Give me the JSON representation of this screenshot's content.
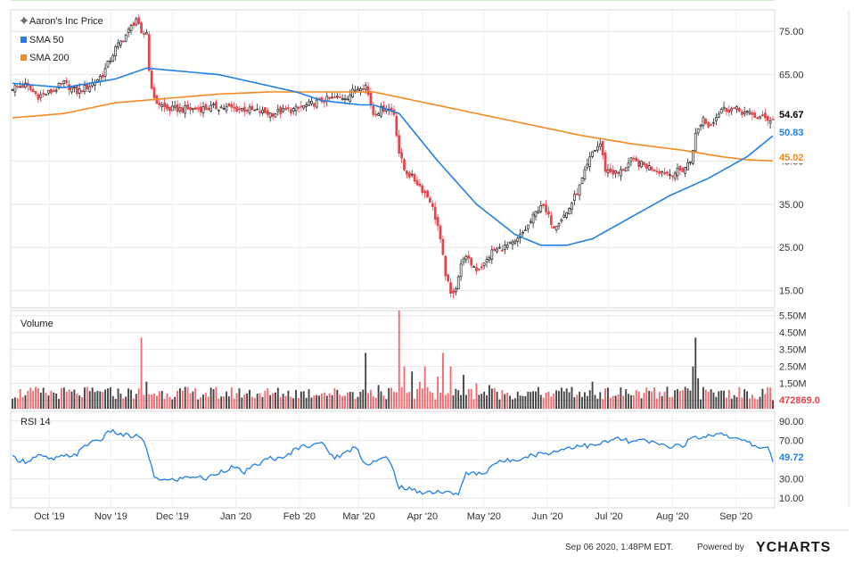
{
  "chart_data": [
    {
      "type": "candlestick",
      "legend": [
        {
          "name": "Aaron's Inc Price",
          "marker": "crosshair",
          "color": "#333333"
        },
        {
          "name": "SMA 50",
          "marker": "square",
          "color": "#1f80e6"
        },
        {
          "name": "SMA 200",
          "marker": "square",
          "color": "#f48a20"
        }
      ],
      "y_ticks": [
        "75.00",
        "65.00",
        "45.00",
        "35.00",
        "25.00",
        "15.00"
      ],
      "ylim": [
        11,
        80
      ],
      "last_labels": [
        {
          "series": "Aaron's Inc Price",
          "value": "54.67",
          "color": "#000000"
        },
        {
          "series": "SMA 50",
          "value": "50.83",
          "color": "#1f80e6"
        },
        {
          "series": "SMA 200",
          "value": "45.02",
          "color": "#f48a20"
        }
      ],
      "price_anchors": [
        [
          0,
          62
        ],
        [
          5,
          62.5
        ],
        [
          10,
          60
        ],
        [
          15,
          61
        ],
        [
          20,
          63
        ],
        [
          25,
          61
        ],
        [
          30,
          62.5
        ],
        [
          35,
          65
        ],
        [
          40,
          71
        ],
        [
          45,
          75
        ],
        [
          48,
          78
        ],
        [
          50,
          74
        ],
        [
          52,
          75
        ],
        [
          53,
          66
        ],
        [
          55,
          59
        ],
        [
          60,
          57
        ],
        [
          70,
          57
        ],
        [
          80,
          57.5
        ],
        [
          90,
          57
        ],
        [
          100,
          56
        ],
        [
          110,
          57
        ],
        [
          120,
          59
        ],
        [
          130,
          60
        ],
        [
          135,
          62.5
        ],
        [
          137,
          62.5
        ],
        [
          140,
          56
        ],
        [
          145,
          57.5
        ],
        [
          148,
          56
        ],
        [
          150,
          47
        ],
        [
          152,
          43
        ],
        [
          157,
          40
        ],
        [
          162,
          36
        ],
        [
          165,
          30
        ],
        [
          168,
          19
        ],
        [
          170,
          14
        ],
        [
          172,
          16
        ],
        [
          175,
          23
        ],
        [
          180,
          20
        ],
        [
          183,
          21
        ],
        [
          186,
          24
        ],
        [
          195,
          26
        ],
        [
          200,
          30
        ],
        [
          205,
          35
        ],
        [
          210,
          30
        ],
        [
          215,
          33
        ],
        [
          220,
          39
        ],
        [
          225,
          47
        ],
        [
          228,
          49
        ],
        [
          230,
          43
        ],
        [
          235,
          42
        ],
        [
          240,
          45
        ],
        [
          245,
          44
        ],
        [
          250,
          43
        ],
        [
          255,
          42
        ],
        [
          260,
          43
        ],
        [
          263,
          45
        ],
        [
          265,
          51
        ],
        [
          268,
          55
        ],
        [
          270,
          53
        ],
        [
          275,
          57
        ],
        [
          280,
          57
        ],
        [
          285,
          56
        ],
        [
          290,
          55
        ],
        [
          295,
          54.67
        ]
      ],
      "sma50_anchors": [
        [
          0,
          63
        ],
        [
          20,
          62
        ],
        [
          40,
          64
        ],
        [
          52,
          66.5
        ],
        [
          80,
          65
        ],
        [
          110,
          61
        ],
        [
          120,
          59
        ],
        [
          135,
          58
        ],
        [
          140,
          58
        ],
        [
          150,
          56
        ],
        [
          165,
          45
        ],
        [
          180,
          35
        ],
        [
          195,
          28
        ],
        [
          205,
          25.5
        ],
        [
          215,
          25.5
        ],
        [
          225,
          27
        ],
        [
          240,
          32
        ],
        [
          255,
          37
        ],
        [
          270,
          41
        ],
        [
          285,
          46
        ],
        [
          295,
          50.83
        ]
      ],
      "sma200_anchors": [
        [
          0,
          55
        ],
        [
          20,
          56
        ],
        [
          40,
          58.5
        ],
        [
          60,
          59.5
        ],
        [
          80,
          60.5
        ],
        [
          100,
          61
        ],
        [
          120,
          61
        ],
        [
          140,
          61
        ],
        [
          160,
          58.5
        ],
        [
          180,
          56
        ],
        [
          200,
          53.5
        ],
        [
          220,
          51
        ],
        [
          240,
          49
        ],
        [
          260,
          47.5
        ],
        [
          275,
          46
        ],
        [
          285,
          45.3
        ],
        [
          295,
          45.02
        ]
      ],
      "overbought_level": 70,
      "oversold_level": 30
    },
    {
      "type": "bar",
      "title": "Volume",
      "y_ticks": [
        "5.50M",
        "4.50M",
        "3.50M",
        "2.50M",
        "1.50M",
        "0.50M"
      ],
      "ylim": [
        0,
        5.8
      ],
      "last_label": "472869.0",
      "spikes": [
        [
          5,
          0.8
        ],
        [
          25,
          0.9
        ],
        [
          35,
          1.0
        ],
        [
          45,
          1.2
        ],
        [
          50,
          4.2
        ],
        [
          52,
          1.6
        ],
        [
          60,
          0.9
        ],
        [
          80,
          0.6
        ],
        [
          100,
          0.8
        ],
        [
          120,
          0.9
        ],
        [
          131,
          1.0
        ],
        [
          137,
          3.3
        ],
        [
          142,
          1.4
        ],
        [
          148,
          1.0
        ],
        [
          150,
          6.0
        ],
        [
          152,
          2.5
        ],
        [
          155,
          2.2
        ],
        [
          158,
          1.6
        ],
        [
          160,
          2.5
        ],
        [
          165,
          1.9
        ],
        [
          167,
          3.3
        ],
        [
          170,
          2.5
        ],
        [
          175,
          2.0
        ],
        [
          180,
          1.5
        ],
        [
          185,
          1.4
        ],
        [
          190,
          1.1
        ],
        [
          200,
          1.0
        ],
        [
          210,
          0.9
        ],
        [
          215,
          1.2
        ],
        [
          220,
          1.0
        ],
        [
          225,
          1.6
        ],
        [
          230,
          1.2
        ],
        [
          240,
          0.8
        ],
        [
          250,
          0.6
        ],
        [
          256,
          0.7
        ],
        [
          262,
          1.2
        ],
        [
          264,
          2.5
        ],
        [
          265,
          4.2
        ],
        [
          266,
          1.8
        ],
        [
          270,
          1.0
        ],
        [
          280,
          0.8
        ],
        [
          290,
          0.7
        ],
        [
          295,
          0.5
        ]
      ]
    },
    {
      "type": "line",
      "title": "RSI 14",
      "y_ticks": [
        "90.00",
        "70.00",
        "50.00",
        "30.00",
        "10.00"
      ],
      "ylim": [
        0,
        100
      ],
      "last_label": "49.72",
      "rsi_anchors": [
        [
          0,
          52
        ],
        [
          5,
          48
        ],
        [
          10,
          54
        ],
        [
          15,
          50
        ],
        [
          20,
          53
        ],
        [
          25,
          56
        ],
        [
          30,
          68
        ],
        [
          35,
          72
        ],
        [
          38,
          80
        ],
        [
          42,
          76
        ],
        [
          46,
          74
        ],
        [
          50,
          74
        ],
        [
          52,
          60
        ],
        [
          55,
          32
        ],
        [
          60,
          28
        ],
        [
          65,
          30
        ],
        [
          70,
          33
        ],
        [
          75,
          30
        ],
        [
          80,
          37
        ],
        [
          85,
          42
        ],
        [
          90,
          37
        ],
        [
          95,
          45
        ],
        [
          100,
          52
        ],
        [
          105,
          50
        ],
        [
          110,
          62
        ],
        [
          115,
          65
        ],
        [
          118,
          68
        ],
        [
          120,
          66
        ],
        [
          125,
          52
        ],
        [
          130,
          58
        ],
        [
          133,
          64
        ],
        [
          135,
          55
        ],
        [
          137,
          45
        ],
        [
          140,
          48
        ],
        [
          143,
          50
        ],
        [
          145,
          52
        ],
        [
          147,
          44
        ],
        [
          150,
          22
        ],
        [
          155,
          18
        ],
        [
          160,
          16
        ],
        [
          165,
          17
        ],
        [
          170,
          15
        ],
        [
          173,
          15
        ],
        [
          176,
          35
        ],
        [
          180,
          36
        ],
        [
          183,
          35
        ],
        [
          186,
          45
        ],
        [
          190,
          48
        ],
        [
          195,
          50
        ],
        [
          200,
          54
        ],
        [
          205,
          56
        ],
        [
          210,
          58
        ],
        [
          215,
          62
        ],
        [
          220,
          65
        ],
        [
          225,
          64
        ],
        [
          230,
          68
        ],
        [
          235,
          72
        ],
        [
          240,
          68
        ],
        [
          245,
          70
        ],
        [
          250,
          66
        ],
        [
          255,
          64
        ],
        [
          260,
          65
        ],
        [
          263,
          70
        ],
        [
          265,
          75
        ],
        [
          268,
          72
        ],
        [
          270,
          75
        ],
        [
          275,
          78
        ],
        [
          280,
          72
        ],
        [
          285,
          68
        ],
        [
          290,
          62
        ],
        [
          293,
          64
        ],
        [
          295,
          49.72
        ]
      ]
    }
  ],
  "x_axis": {
    "labels": [
      "Oct '19",
      "Nov '19",
      "Dec '19",
      "Jan '20",
      "Feb '20",
      "Mar '20",
      "Apr '20",
      "May '20",
      "Jun '20",
      "Jul '20",
      "Aug '20",
      "Sep '20"
    ],
    "label_days": [
      18,
      48,
      78,
      109,
      140,
      169,
      200,
      230,
      261,
      291,
      322,
      353
    ]
  },
  "footer": {
    "timestamp": "Sep 06 2020, 1:48PM EDT.",
    "powered_by": "Powered by",
    "brand": "YCHARTS",
    "brand_color": "#1a1a1a"
  },
  "colors": {
    "candle_up": "#222222",
    "candle_down": "#e8424a",
    "volume_up": "#444444",
    "volume_down": "#f16a70",
    "rsi_line": "#1f80e6",
    "rsi_fill": "#6fb4ee",
    "grid": "#e6e6e6",
    "overbought_line": "#f2b0b0",
    "oversold_line": "#9fd89f"
  }
}
